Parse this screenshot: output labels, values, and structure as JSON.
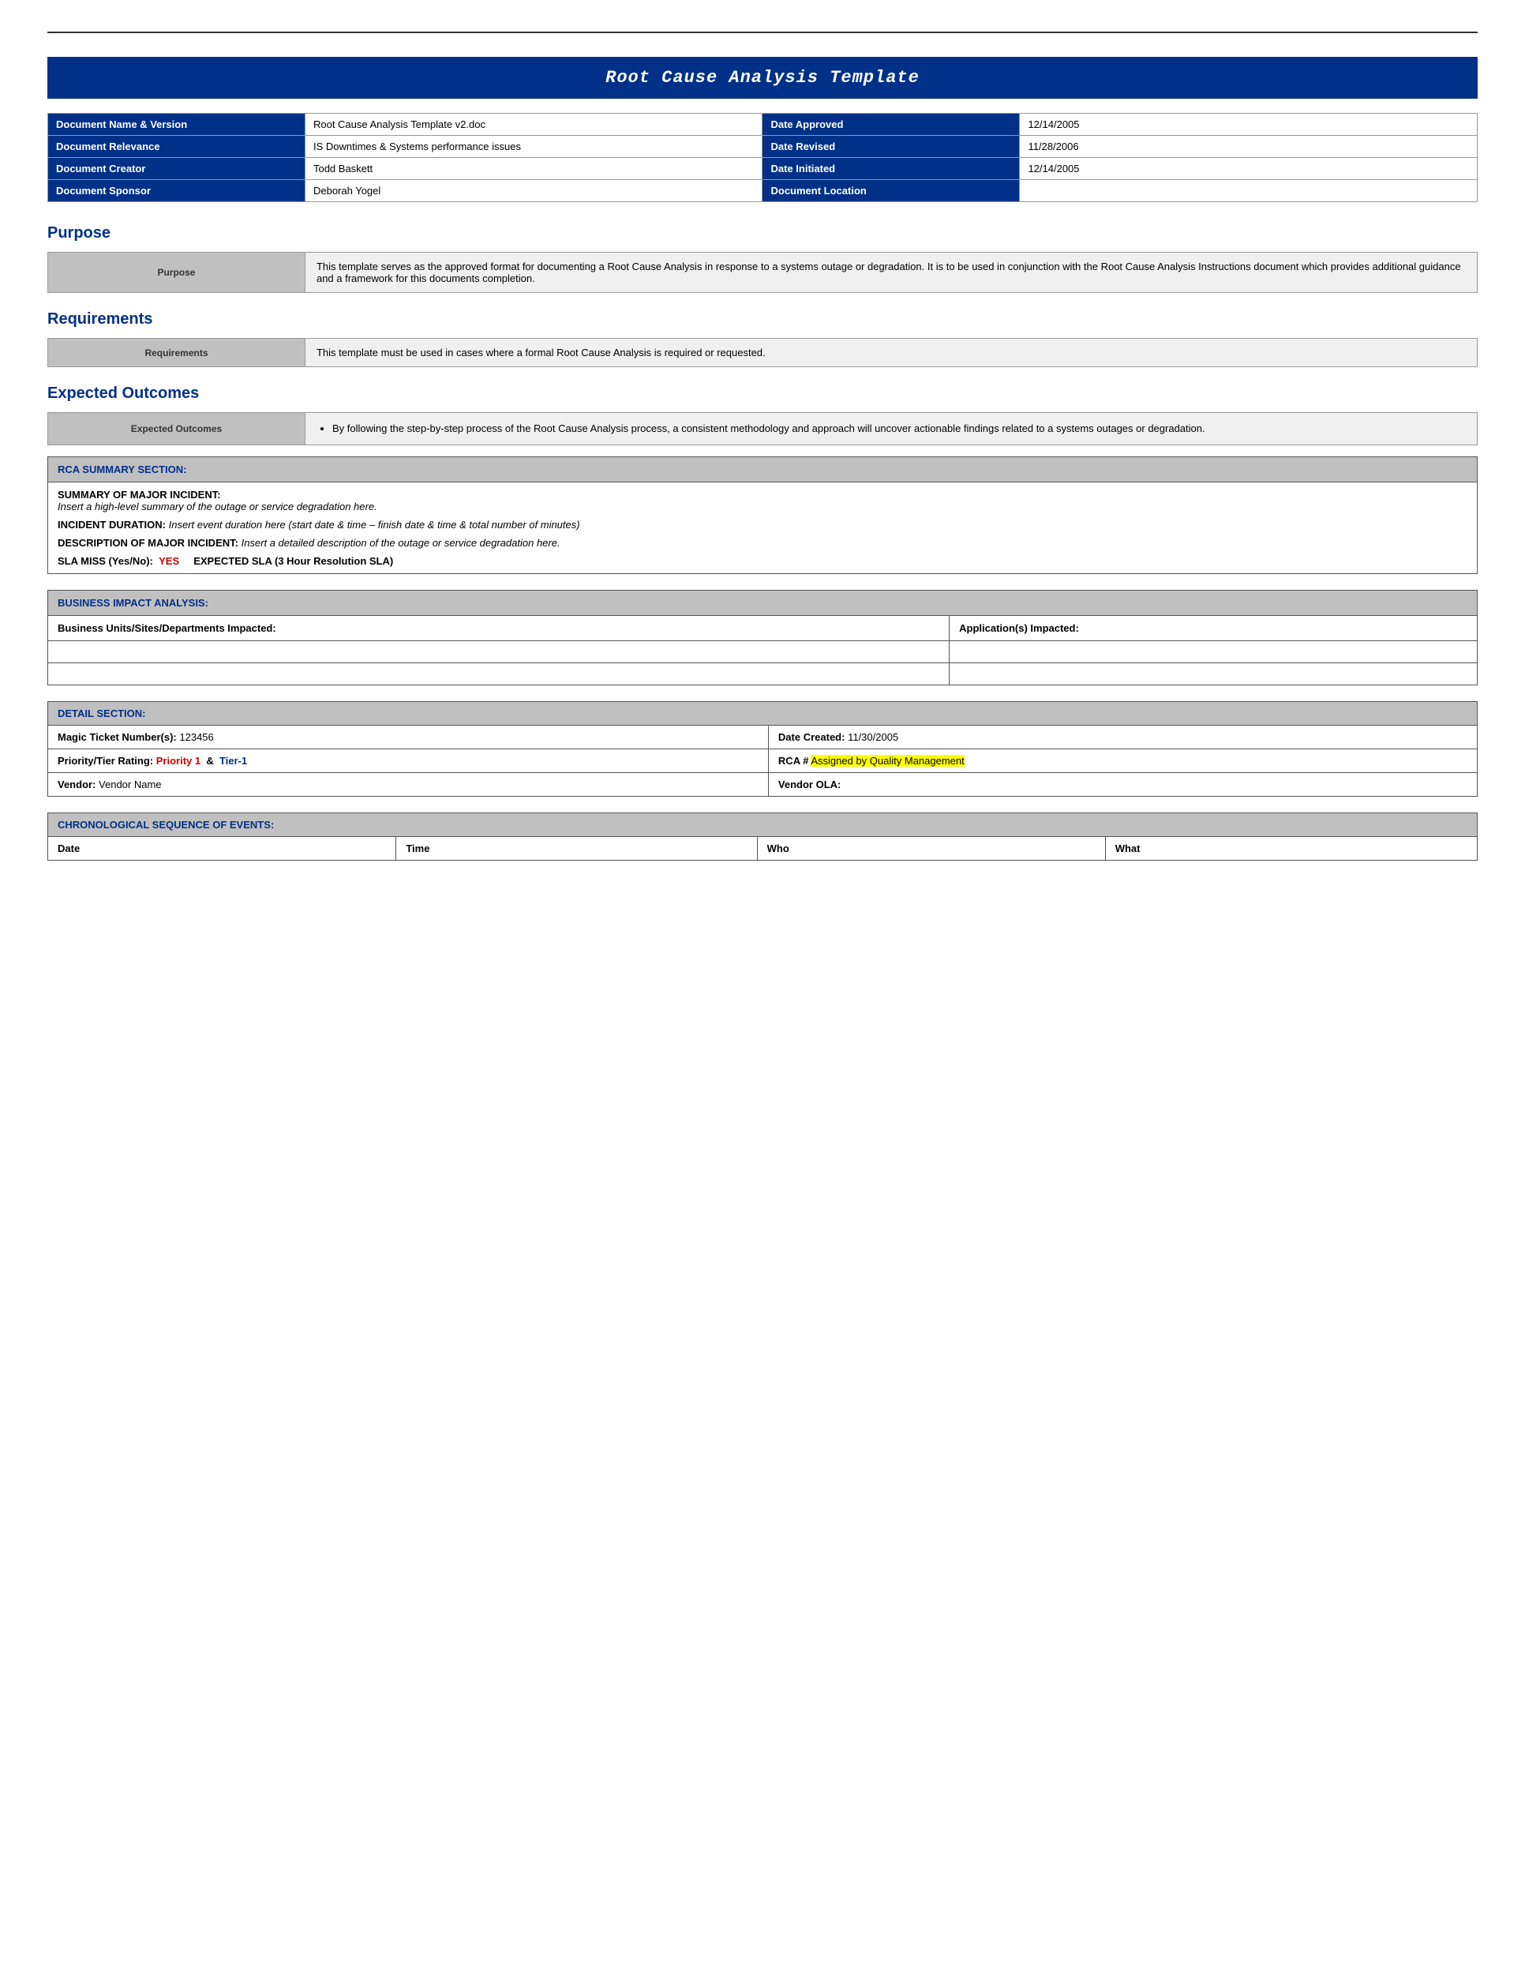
{
  "page": {
    "title": "Root Cause Analysis Template"
  },
  "header_table": {
    "rows": [
      {
        "left_label": "Document Name & Version",
        "left_value": "Root Cause Analysis Template v2.doc",
        "right_label": "Date Approved",
        "right_value": "12/14/2005"
      },
      {
        "left_label": "Document Relevance",
        "left_value": "IS Downtimes & Systems performance issues",
        "right_label": "Date Revised",
        "right_value": "11/28/2006"
      },
      {
        "left_label": "Document Creator",
        "left_value": "Todd Baskett",
        "right_label": "Date Initiated",
        "right_value": "12/14/2005"
      },
      {
        "left_label": "Document Sponsor",
        "left_value": "Deborah Yogel",
        "right_label": "Document Location",
        "right_value": ""
      }
    ]
  },
  "sections": {
    "purpose": {
      "heading": "Purpose",
      "sidebar_label": "Purpose",
      "text": "This template serves as the approved format for documenting a Root Cause Analysis in response to a systems outage or degradation. It is to be used in conjunction with the Root Cause Analysis Instructions document which provides additional guidance and a framework for this documents completion."
    },
    "requirements": {
      "heading": "Requirements",
      "sidebar_label": "Requirements",
      "text": "This template must be used in cases where a formal Root Cause Analysis is required or requested."
    },
    "expected_outcomes": {
      "heading": "Expected Outcomes",
      "sidebar_label": "Expected Outcomes",
      "bullet": "By following the step-by-step process of the Root Cause Analysis process, a consistent methodology and approach will uncover actionable findings related to a systems outages or degradation."
    }
  },
  "rca_summary": {
    "section_header": "RCA SUMMARY SECTION:",
    "summary_header": "SUMMARY OF MAJOR INCIDENT:",
    "summary_text": "Insert a high-level summary of the outage or service degradation here.",
    "incident_duration_label": "INCIDENT DURATION:",
    "incident_duration_text": "Insert event duration here (start date &  time – finish date & time & total number of minutes)",
    "description_label": "DESCRIPTION OF MAJOR INCIDENT:",
    "description_text": "Insert a detailed description of the outage or service degradation here.",
    "sla_miss_label": "SLA MISS (Yes/No):",
    "sla_miss_value": "YES",
    "expected_sla_text": "EXPECTED SLA (3 Hour Resolution SLA)"
  },
  "business_impact": {
    "section_header": "BUSINESS IMPACT ANALYSIS:",
    "col1_header": "Business Units/Sites/Departments Impacted:",
    "col2_header": "Application(s) Impacted:"
  },
  "detail_section": {
    "section_header": "DETAIL SECTION:",
    "magic_ticket_label": "Magic Ticket Number(s):",
    "magic_ticket_value": "123456",
    "date_created_label": "Date Created:",
    "date_created_value": "11/30/2005",
    "priority_label": "Priority/Tier Rating:",
    "priority_value": "Priority 1",
    "tier_value": "Tier-1",
    "priority_separator": "&",
    "rca_label": "RCA #",
    "rca_value": "Assigned by Quality Management",
    "vendor_label": "Vendor:",
    "vendor_value": "Vendor Name",
    "vendor_ola_label": "Vendor OLA:",
    "vendor_ola_value": ""
  },
  "chronological": {
    "section_header": "CHRONOLOGICAL SEQUENCE OF EVENTS:",
    "col_date": "Date",
    "col_time": "Time",
    "col_who": "Who",
    "col_what": "What"
  }
}
